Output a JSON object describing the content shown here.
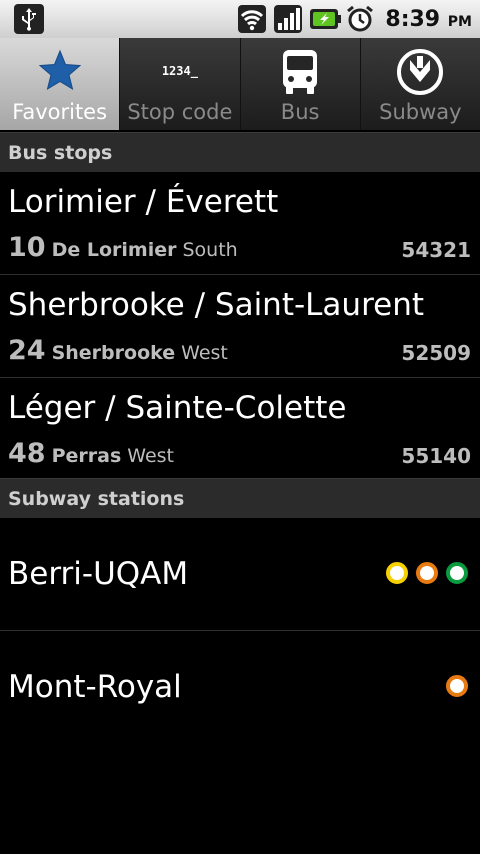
{
  "status_bar": {
    "time": "8:39",
    "ampm": "PM"
  },
  "tabs": [
    {
      "label": "Favorites",
      "icon": "star-icon",
      "active": true
    },
    {
      "label": "Stop code",
      "icon": "stop-code-icon",
      "glyph": "1234_",
      "active": false
    },
    {
      "label": "Bus",
      "icon": "bus-icon",
      "active": false
    },
    {
      "label": "Subway",
      "icon": "metro-icon",
      "active": false
    }
  ],
  "sections": {
    "bus_stops": "Bus stops",
    "subway_stations": "Subway stations"
  },
  "bus_stops": [
    {
      "name": "Lorimier / Éverett",
      "route": "10",
      "street": "De Lorimier",
      "direction": "South",
      "code": "54321"
    },
    {
      "name": "Sherbrooke / Saint-Laurent",
      "route": "24",
      "street": "Sherbrooke",
      "direction": "West",
      "code": "52509"
    },
    {
      "name": "Léger / Sainte-Colette",
      "route": "48",
      "street": "Perras",
      "direction": "West",
      "code": "55140"
    }
  ],
  "subway_stations": [
    {
      "name": "Berri-UQAM",
      "lines": [
        "#f7d000",
        "#e87a12",
        "#0a9b3f"
      ]
    },
    {
      "name": "Mont-Royal",
      "lines": [
        "#e87a12"
      ]
    }
  ],
  "colors": {
    "tab_active_bg": "#bdbdbd",
    "star": "#1f5fa8",
    "line_yellow": "#f7d000",
    "line_orange": "#e87a12",
    "line_green": "#0a9b3f"
  }
}
